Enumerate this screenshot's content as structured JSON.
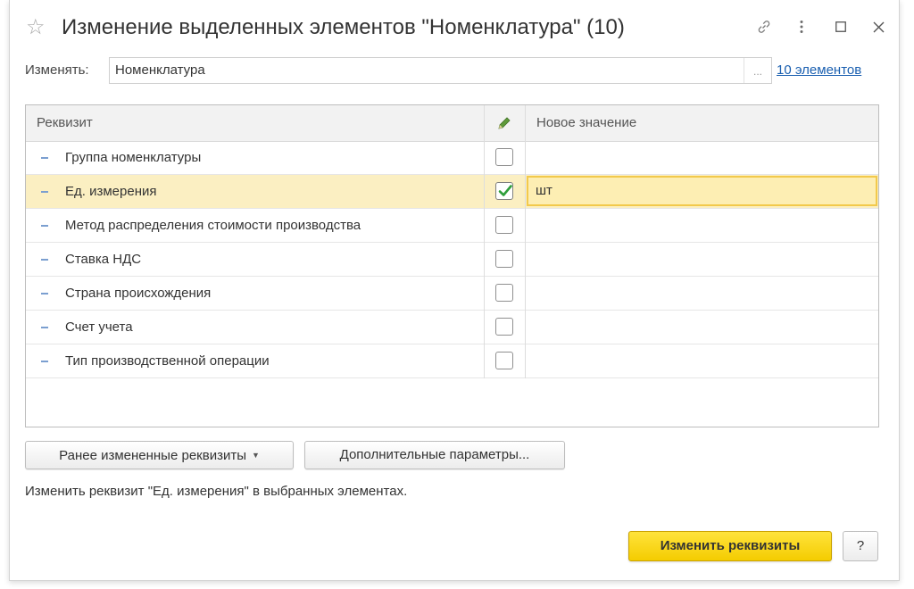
{
  "window": {
    "title": "Изменение выделенных элементов \"Номенклатура\" (10)",
    "favorite_icon": "star-outline-icon"
  },
  "target": {
    "label": "Изменять:",
    "value": "Номенклатура",
    "select_button": "...",
    "count_link": "10 элементов"
  },
  "table": {
    "headers": {
      "attribute": "Реквизит",
      "edit_icon": "pencil-icon",
      "new_value": "Новое значение"
    },
    "rows": [
      {
        "name": "Группа номенклатуры",
        "checked": false,
        "value": ""
      },
      {
        "name": "Ед. измерения",
        "checked": true,
        "value": "шт",
        "selected": true
      },
      {
        "name": "Метод распределения стоимости производства",
        "checked": false,
        "value": ""
      },
      {
        "name": "Ставка НДС",
        "checked": false,
        "value": ""
      },
      {
        "name": "Страна происхождения",
        "checked": false,
        "value": ""
      },
      {
        "name": "Счет учета",
        "checked": false,
        "value": ""
      },
      {
        "name": "Тип производственной операции",
        "checked": false,
        "value": ""
      }
    ]
  },
  "buttons": {
    "previously_changed": "Ранее измененные реквизиты",
    "additional_params": "Дополнительные параметры...",
    "apply": "Изменить реквизиты",
    "help": "?"
  },
  "status": "Изменить реквизит \"Ед. измерения\" в выбранных элементах.",
  "colors": {
    "accent_yellow": "#f4cc00",
    "selected_row": "#fbefc2",
    "link": "#1a5fb0",
    "checkmark": "#2e9e3a"
  }
}
